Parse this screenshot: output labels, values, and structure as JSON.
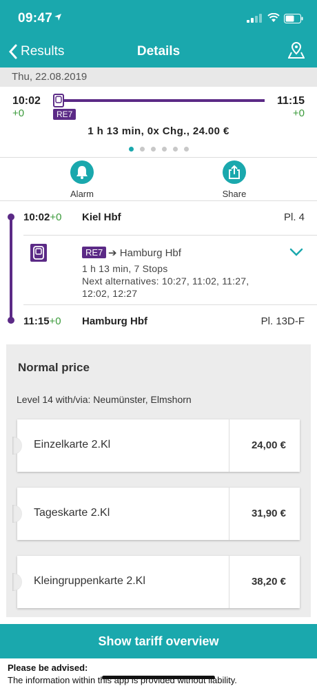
{
  "status_bar": {
    "time": "09:47"
  },
  "nav": {
    "back_label": "Results",
    "title": "Details"
  },
  "date": "Thu, 22.08.2019",
  "summary": {
    "dep_time": "10:02",
    "dep_delay": "+0",
    "arr_time": "11:15",
    "arr_delay": "+0",
    "train": "RE7",
    "info": "1 h 13 min,  0x Chg.,  24.00  €",
    "pages": 6,
    "active_page": 1
  },
  "actions": {
    "alarm": "Alarm",
    "share": "Share"
  },
  "route": {
    "from": {
      "time": "10:02",
      "delay": "+0",
      "name": "Kiel Hbf",
      "platform": "Pl. 4"
    },
    "leg": {
      "train": "RE7",
      "direction": "➔ Hamburg Hbf",
      "duration": "1 h 13 min, 7 Stops",
      "alternatives_1": "Next alternatives: 10:27, 11:02, 11:27,",
      "alternatives_2": "12:02, 12:27"
    },
    "to": {
      "time": "11:15",
      "delay": "+0",
      "name": "Hamburg Hbf",
      "platform": "Pl. 13D-F"
    }
  },
  "price": {
    "title": "Normal price",
    "level": "Level 14 with/via: Neumünster, Elmshorn",
    "tickets": [
      {
        "name": "Einzelkarte 2.Kl",
        "price": "24,00 €"
      },
      {
        "name": "Tageskarte 2.Kl",
        "price": "31,90 €"
      },
      {
        "name": "Kleingruppenkarte 2.Kl",
        "price": "38,20 €"
      }
    ]
  },
  "tariff_button": "Show tariff overview",
  "advice": {
    "title": "Please be advised:",
    "text": "The information within this app is provided without liability."
  },
  "colors": {
    "accent": "#1aa8ad",
    "train": "#5b2a86",
    "delay": "#3a9a3a"
  }
}
